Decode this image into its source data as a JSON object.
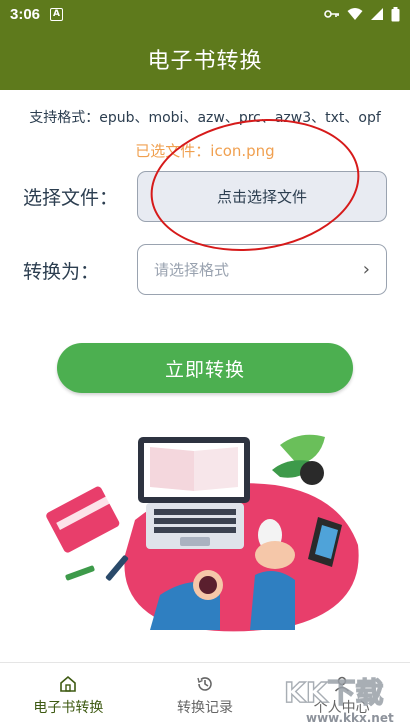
{
  "status_bar": {
    "time": "3:06",
    "notification_letter": "A"
  },
  "app_bar": {
    "title": "电子书转换"
  },
  "formats_text": "支持格式：epub、mobi、azw、prc、azw3、txt、opf",
  "selected_file_text": "已选文件：icon.png",
  "file_row": {
    "label": "选择文件：",
    "button_label": "点击选择文件"
  },
  "format_row": {
    "label": "转换为：",
    "placeholder": "请选择格式"
  },
  "convert_button": "立即转换",
  "bottom_nav": [
    {
      "label": "电子书转换",
      "icon": "home-icon",
      "active": true
    },
    {
      "label": "转换记录",
      "icon": "history-icon",
      "active": false
    },
    {
      "label": "个人中心",
      "icon": "person-icon",
      "active": false
    }
  ],
  "watermark": {
    "brand": "KK下载",
    "url": "www.kkx.net"
  },
  "colors": {
    "header": "#5e7a1c",
    "accent_green": "#4caf50",
    "selected_orange": "#f0a050",
    "annotation_red": "#d61a1a"
  }
}
